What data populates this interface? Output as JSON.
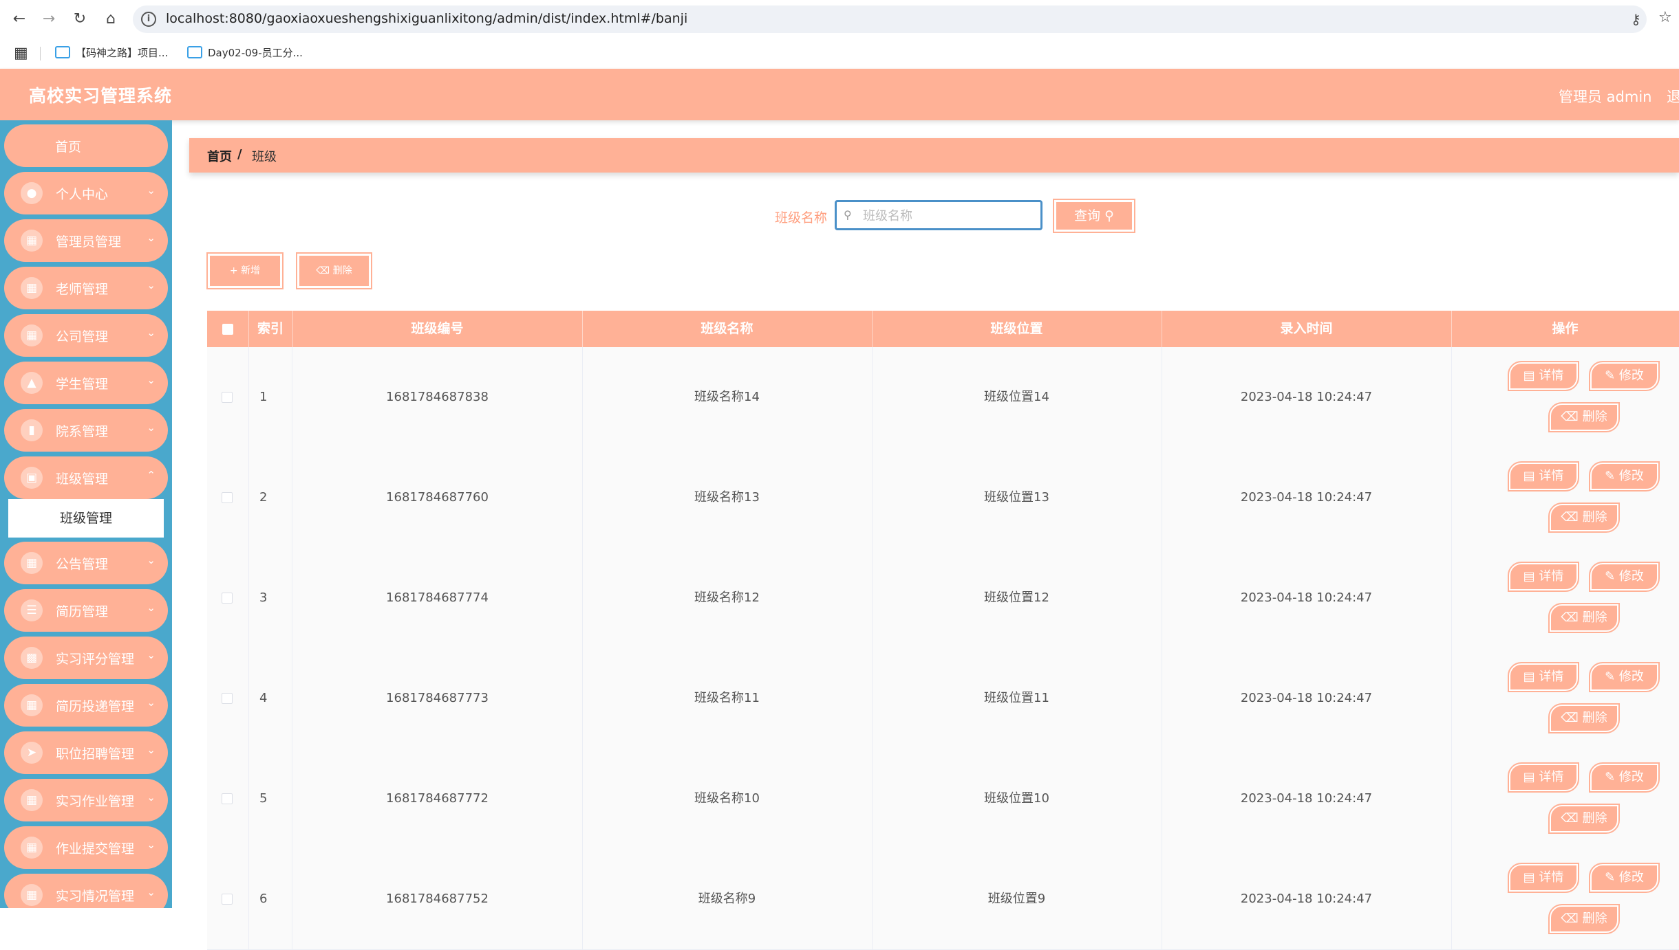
{
  "browser": {
    "url": "localhost:8080/gaoxiaoxueshengshixiguanlixitong/admin/dist/index.html#/banji",
    "bookmarks": [
      "【码神之路】项目...",
      "Day02-09-员工分..."
    ]
  },
  "header": {
    "title": "高校实习管理系统",
    "user_label": "管理员 admin",
    "logout_label": "退"
  },
  "sidebar": {
    "items": [
      {
        "label": "首页",
        "icon": "home"
      },
      {
        "label": "个人中心",
        "icon": "user-icon"
      },
      {
        "label": "管理员管理",
        "icon": "grid-icon"
      },
      {
        "label": "老师管理",
        "icon": "grid-icon"
      },
      {
        "label": "公司管理",
        "icon": "grid-icon"
      },
      {
        "label": "学生管理",
        "icon": "thumb-icon"
      },
      {
        "label": "院系管理",
        "icon": "bar-chart-icon"
      },
      {
        "label": "班级管理",
        "icon": "briefcase-icon"
      },
      {
        "label": "公告管理",
        "icon": "grid-icon"
      },
      {
        "label": "简历管理",
        "icon": "list-icon"
      },
      {
        "label": "实习评分管理",
        "icon": "chat-icon"
      },
      {
        "label": "简历投递管理",
        "icon": "grid-icon"
      },
      {
        "label": "职位招聘管理",
        "icon": "send-icon"
      },
      {
        "label": "实习作业管理",
        "icon": "grid-icon"
      },
      {
        "label": "作业提交管理",
        "icon": "grid-icon"
      },
      {
        "label": "实习情况管理",
        "icon": "grid-icon"
      }
    ],
    "submenu_label": "班级管理"
  },
  "breadcrumb": {
    "home": "首页",
    "separator": "/",
    "current": "班级"
  },
  "search": {
    "label": "班级名称",
    "placeholder": "班级名称",
    "query_label": "查询"
  },
  "actions": {
    "add_label": "新增",
    "delete_label": "删除"
  },
  "table": {
    "columns": [
      "索引",
      "班级编号",
      "班级名称",
      "班级位置",
      "录入时间",
      "操作"
    ],
    "rows": [
      {
        "index": "1",
        "code": "1681784687838",
        "name": "班级名称14",
        "location": "班级位置14",
        "time": "2023-04-18 10:24:47"
      },
      {
        "index": "2",
        "code": "1681784687760",
        "name": "班级名称13",
        "location": "班级位置13",
        "time": "2023-04-18 10:24:47"
      },
      {
        "index": "3",
        "code": "1681784687774",
        "name": "班级名称12",
        "location": "班级位置12",
        "time": "2023-04-18 10:24:47"
      },
      {
        "index": "4",
        "code": "1681784687773",
        "name": "班级名称11",
        "location": "班级位置11",
        "time": "2023-04-18 10:24:47"
      },
      {
        "index": "5",
        "code": "1681784687772",
        "name": "班级名称10",
        "location": "班级位置10",
        "time": "2023-04-18 10:24:47"
      },
      {
        "index": "6",
        "code": "1681784687752",
        "name": "班级名称9",
        "location": "班级位置9",
        "time": "2023-04-18 10:24:47"
      }
    ],
    "op_detail": "详情",
    "op_edit": "修改",
    "op_delete": "删除"
  },
  "colors": {
    "accent": "#ffb196",
    "sidebar_bg": "#4aa8cc",
    "search_border": "#4a90c8"
  }
}
